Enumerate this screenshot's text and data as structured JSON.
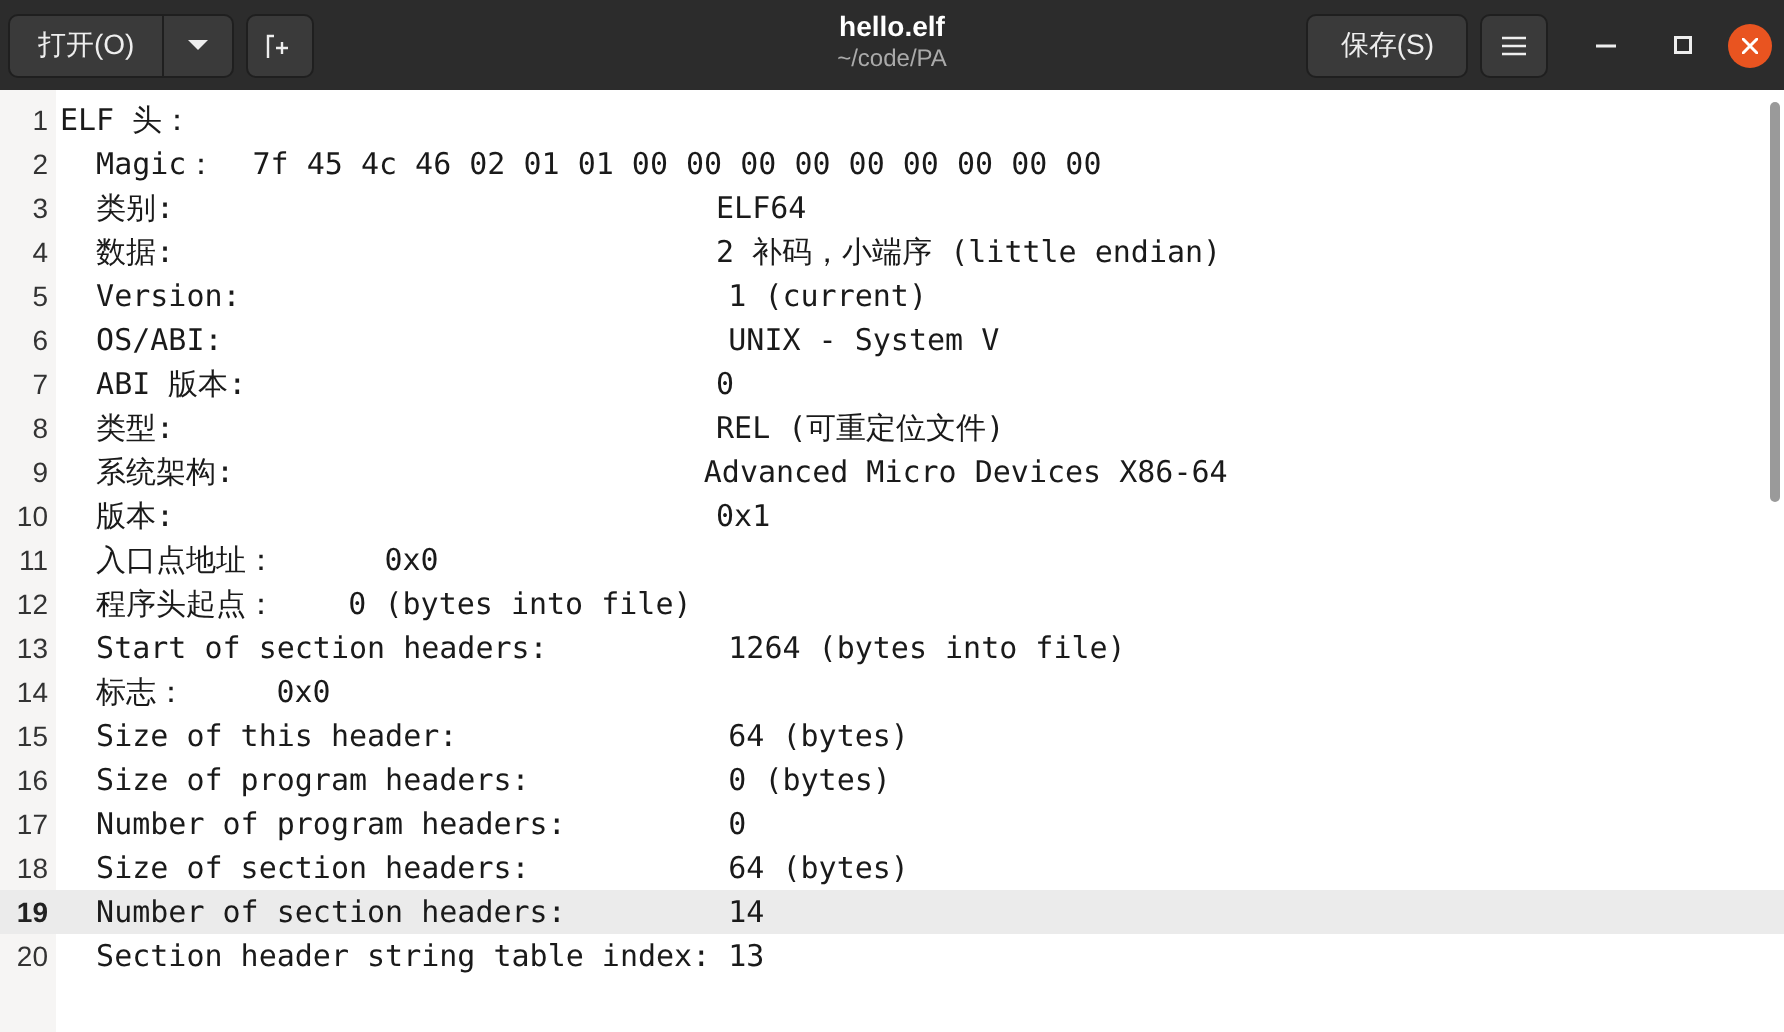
{
  "header": {
    "open_button": "打开(O)",
    "title": "hello.elf",
    "subtitle": "~/code/PA",
    "save_button": "保存(S)"
  },
  "editor": {
    "lines": [
      {
        "number": "1",
        "text": "ELF 头：",
        "current": false
      },
      {
        "number": "2",
        "text": "  Magic：  7f 45 4c 46 02 01 01 00 00 00 00 00 00 00 00 00",
        "current": false
      },
      {
        "number": "3",
        "text": "  类别:                              ELF64",
        "current": false
      },
      {
        "number": "4",
        "text": "  数据:                              2 补码，小端序 (little endian)",
        "current": false
      },
      {
        "number": "5",
        "text": "  Version:                           1 (current)",
        "current": false
      },
      {
        "number": "6",
        "text": "  OS/ABI:                            UNIX - System V",
        "current": false
      },
      {
        "number": "7",
        "text": "  ABI 版本:                          0",
        "current": false
      },
      {
        "number": "8",
        "text": "  类型:                              REL (可重定位文件)",
        "current": false
      },
      {
        "number": "9",
        "text": "  系统架构:                          Advanced Micro Devices X86-64",
        "current": false
      },
      {
        "number": "10",
        "text": "  版本:                              0x1",
        "current": false
      },
      {
        "number": "11",
        "text": "  入口点地址：      0x0",
        "current": false
      },
      {
        "number": "12",
        "text": "  程序头起点：    0 (bytes into file)",
        "current": false
      },
      {
        "number": "13",
        "text": "  Start of section headers:          1264 (bytes into file)",
        "current": false
      },
      {
        "number": "14",
        "text": "  标志：     0x0",
        "current": false
      },
      {
        "number": "15",
        "text": "  Size of this header:               64 (bytes)",
        "current": false
      },
      {
        "number": "16",
        "text": "  Size of program headers:           0 (bytes)",
        "current": false
      },
      {
        "number": "17",
        "text": "  Number of program headers:         0",
        "current": false
      },
      {
        "number": "18",
        "text": "  Size of section headers:           64 (bytes)",
        "current": false
      },
      {
        "number": "19",
        "text": "  Number of section headers:         14",
        "current": true
      },
      {
        "number": "20",
        "text": "  Section header string table index: 13",
        "current": false
      }
    ]
  }
}
